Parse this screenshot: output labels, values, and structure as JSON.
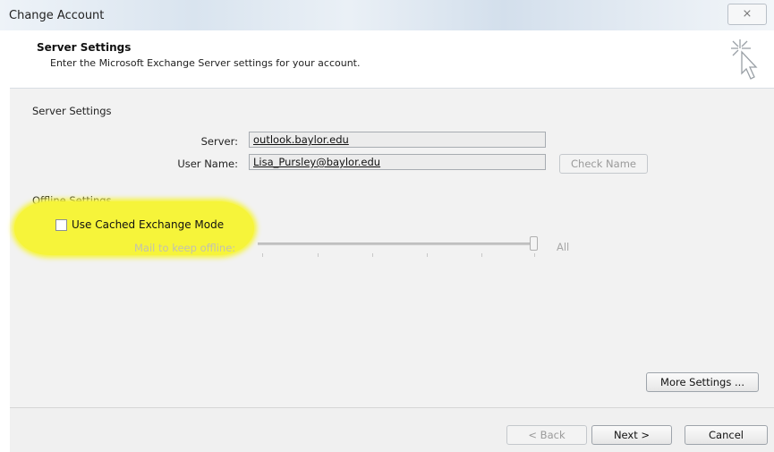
{
  "window": {
    "title": "Change Account",
    "close_glyph": "⨯"
  },
  "header": {
    "title": "Server Settings",
    "subtitle": "Enter the Microsoft Exchange Server settings for your account.",
    "icon": "wizard-cursor-icon"
  },
  "server_settings": {
    "section_label": "Server Settings",
    "server_label": "Server:",
    "server_value": "outlook.baylor.edu",
    "username_label": "User Name:",
    "username_value": "Lisa_Pursley@baylor.edu",
    "check_name_label": "Check Name"
  },
  "offline_settings": {
    "section_label": "Offline Settings",
    "cached_mode_label": "Use Cached Exchange Mode",
    "cached_mode_checked": false,
    "slider_label": "Mail to keep offline:",
    "slider_value_label": "All",
    "slider_level": 1.0
  },
  "buttons": {
    "more_settings": "More Settings ...",
    "back": "< Back",
    "next": "Next >",
    "cancel": "Cancel"
  },
  "colors": {
    "highlight": "#f6f43a"
  }
}
